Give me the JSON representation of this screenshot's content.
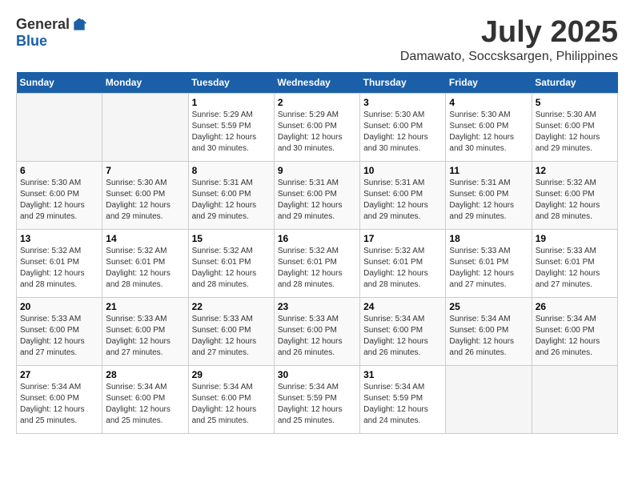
{
  "header": {
    "logo_general": "General",
    "logo_blue": "Blue",
    "month_title": "July 2025",
    "location": "Damawato, Soccsksargen, Philippines"
  },
  "weekdays": [
    "Sunday",
    "Monday",
    "Tuesday",
    "Wednesday",
    "Thursday",
    "Friday",
    "Saturday"
  ],
  "weeks": [
    [
      {
        "day": "",
        "info": ""
      },
      {
        "day": "",
        "info": ""
      },
      {
        "day": "1",
        "info": "Sunrise: 5:29 AM\nSunset: 5:59 PM\nDaylight: 12 hours and 30 minutes."
      },
      {
        "day": "2",
        "info": "Sunrise: 5:29 AM\nSunset: 6:00 PM\nDaylight: 12 hours and 30 minutes."
      },
      {
        "day": "3",
        "info": "Sunrise: 5:30 AM\nSunset: 6:00 PM\nDaylight: 12 hours and 30 minutes."
      },
      {
        "day": "4",
        "info": "Sunrise: 5:30 AM\nSunset: 6:00 PM\nDaylight: 12 hours and 30 minutes."
      },
      {
        "day": "5",
        "info": "Sunrise: 5:30 AM\nSunset: 6:00 PM\nDaylight: 12 hours and 29 minutes."
      }
    ],
    [
      {
        "day": "6",
        "info": "Sunrise: 5:30 AM\nSunset: 6:00 PM\nDaylight: 12 hours and 29 minutes."
      },
      {
        "day": "7",
        "info": "Sunrise: 5:30 AM\nSunset: 6:00 PM\nDaylight: 12 hours and 29 minutes."
      },
      {
        "day": "8",
        "info": "Sunrise: 5:31 AM\nSunset: 6:00 PM\nDaylight: 12 hours and 29 minutes."
      },
      {
        "day": "9",
        "info": "Sunrise: 5:31 AM\nSunset: 6:00 PM\nDaylight: 12 hours and 29 minutes."
      },
      {
        "day": "10",
        "info": "Sunrise: 5:31 AM\nSunset: 6:00 PM\nDaylight: 12 hours and 29 minutes."
      },
      {
        "day": "11",
        "info": "Sunrise: 5:31 AM\nSunset: 6:00 PM\nDaylight: 12 hours and 29 minutes."
      },
      {
        "day": "12",
        "info": "Sunrise: 5:32 AM\nSunset: 6:00 PM\nDaylight: 12 hours and 28 minutes."
      }
    ],
    [
      {
        "day": "13",
        "info": "Sunrise: 5:32 AM\nSunset: 6:01 PM\nDaylight: 12 hours and 28 minutes."
      },
      {
        "day": "14",
        "info": "Sunrise: 5:32 AM\nSunset: 6:01 PM\nDaylight: 12 hours and 28 minutes."
      },
      {
        "day": "15",
        "info": "Sunrise: 5:32 AM\nSunset: 6:01 PM\nDaylight: 12 hours and 28 minutes."
      },
      {
        "day": "16",
        "info": "Sunrise: 5:32 AM\nSunset: 6:01 PM\nDaylight: 12 hours and 28 minutes."
      },
      {
        "day": "17",
        "info": "Sunrise: 5:32 AM\nSunset: 6:01 PM\nDaylight: 12 hours and 28 minutes."
      },
      {
        "day": "18",
        "info": "Sunrise: 5:33 AM\nSunset: 6:01 PM\nDaylight: 12 hours and 27 minutes."
      },
      {
        "day": "19",
        "info": "Sunrise: 5:33 AM\nSunset: 6:01 PM\nDaylight: 12 hours and 27 minutes."
      }
    ],
    [
      {
        "day": "20",
        "info": "Sunrise: 5:33 AM\nSunset: 6:00 PM\nDaylight: 12 hours and 27 minutes."
      },
      {
        "day": "21",
        "info": "Sunrise: 5:33 AM\nSunset: 6:00 PM\nDaylight: 12 hours and 27 minutes."
      },
      {
        "day": "22",
        "info": "Sunrise: 5:33 AM\nSunset: 6:00 PM\nDaylight: 12 hours and 27 minutes."
      },
      {
        "day": "23",
        "info": "Sunrise: 5:33 AM\nSunset: 6:00 PM\nDaylight: 12 hours and 26 minutes."
      },
      {
        "day": "24",
        "info": "Sunrise: 5:34 AM\nSunset: 6:00 PM\nDaylight: 12 hours and 26 minutes."
      },
      {
        "day": "25",
        "info": "Sunrise: 5:34 AM\nSunset: 6:00 PM\nDaylight: 12 hours and 26 minutes."
      },
      {
        "day": "26",
        "info": "Sunrise: 5:34 AM\nSunset: 6:00 PM\nDaylight: 12 hours and 26 minutes."
      }
    ],
    [
      {
        "day": "27",
        "info": "Sunrise: 5:34 AM\nSunset: 6:00 PM\nDaylight: 12 hours and 25 minutes."
      },
      {
        "day": "28",
        "info": "Sunrise: 5:34 AM\nSunset: 6:00 PM\nDaylight: 12 hours and 25 minutes."
      },
      {
        "day": "29",
        "info": "Sunrise: 5:34 AM\nSunset: 6:00 PM\nDaylight: 12 hours and 25 minutes."
      },
      {
        "day": "30",
        "info": "Sunrise: 5:34 AM\nSunset: 5:59 PM\nDaylight: 12 hours and 25 minutes."
      },
      {
        "day": "31",
        "info": "Sunrise: 5:34 AM\nSunset: 5:59 PM\nDaylight: 12 hours and 24 minutes."
      },
      {
        "day": "",
        "info": ""
      },
      {
        "day": "",
        "info": ""
      }
    ]
  ]
}
